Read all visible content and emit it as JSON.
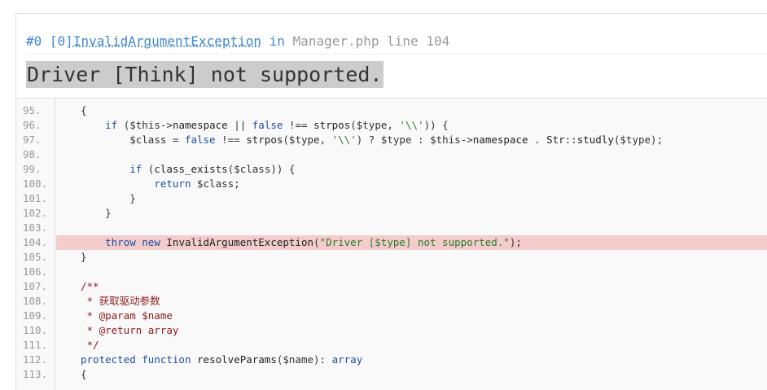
{
  "trace": {
    "index": "#0",
    "type_prefix": "[0]",
    "exception_class": "InvalidArgumentException",
    "in_word": "in",
    "file": "Manager.php",
    "line_label": "line 104"
  },
  "message": "Driver [Think] not supported.",
  "colors": {
    "link": "#4288ce",
    "highlight_row": "#f4cccc",
    "message_bg": "#cccccc"
  },
  "source": {
    "highlight_line": 104,
    "lines": [
      {
        "no": "95.",
        "code": "{"
      },
      {
        "no": "96.",
        "code": "    if ($this->namespace || false !== strpos($type, '\\\\')) {"
      },
      {
        "no": "97.",
        "code": "        $class = false !== strpos($type, '\\\\') ? $type : $this->namespace . Str::studly($type);"
      },
      {
        "no": "98.",
        "code": ""
      },
      {
        "no": "99.",
        "code": "        if (class_exists($class)) {"
      },
      {
        "no": "100.",
        "code": "            return $class;"
      },
      {
        "no": "101.",
        "code": "        }"
      },
      {
        "no": "102.",
        "code": "    }"
      },
      {
        "no": "103.",
        "code": ""
      },
      {
        "no": "104.",
        "code": "    throw new InvalidArgumentException(\"Driver [$type] not supported.\");"
      },
      {
        "no": "105.",
        "code": "}"
      },
      {
        "no": "106.",
        "code": ""
      },
      {
        "no": "107.",
        "code": "/**"
      },
      {
        "no": "108.",
        "code": " * 获取驱动参数"
      },
      {
        "no": "109.",
        "code": " * @param $name"
      },
      {
        "no": "110.",
        "code": " * @return array"
      },
      {
        "no": "111.",
        "code": " */"
      },
      {
        "no": "112.",
        "code": "protected function resolveParams($name): array"
      },
      {
        "no": "113.",
        "code": "{"
      }
    ]
  }
}
